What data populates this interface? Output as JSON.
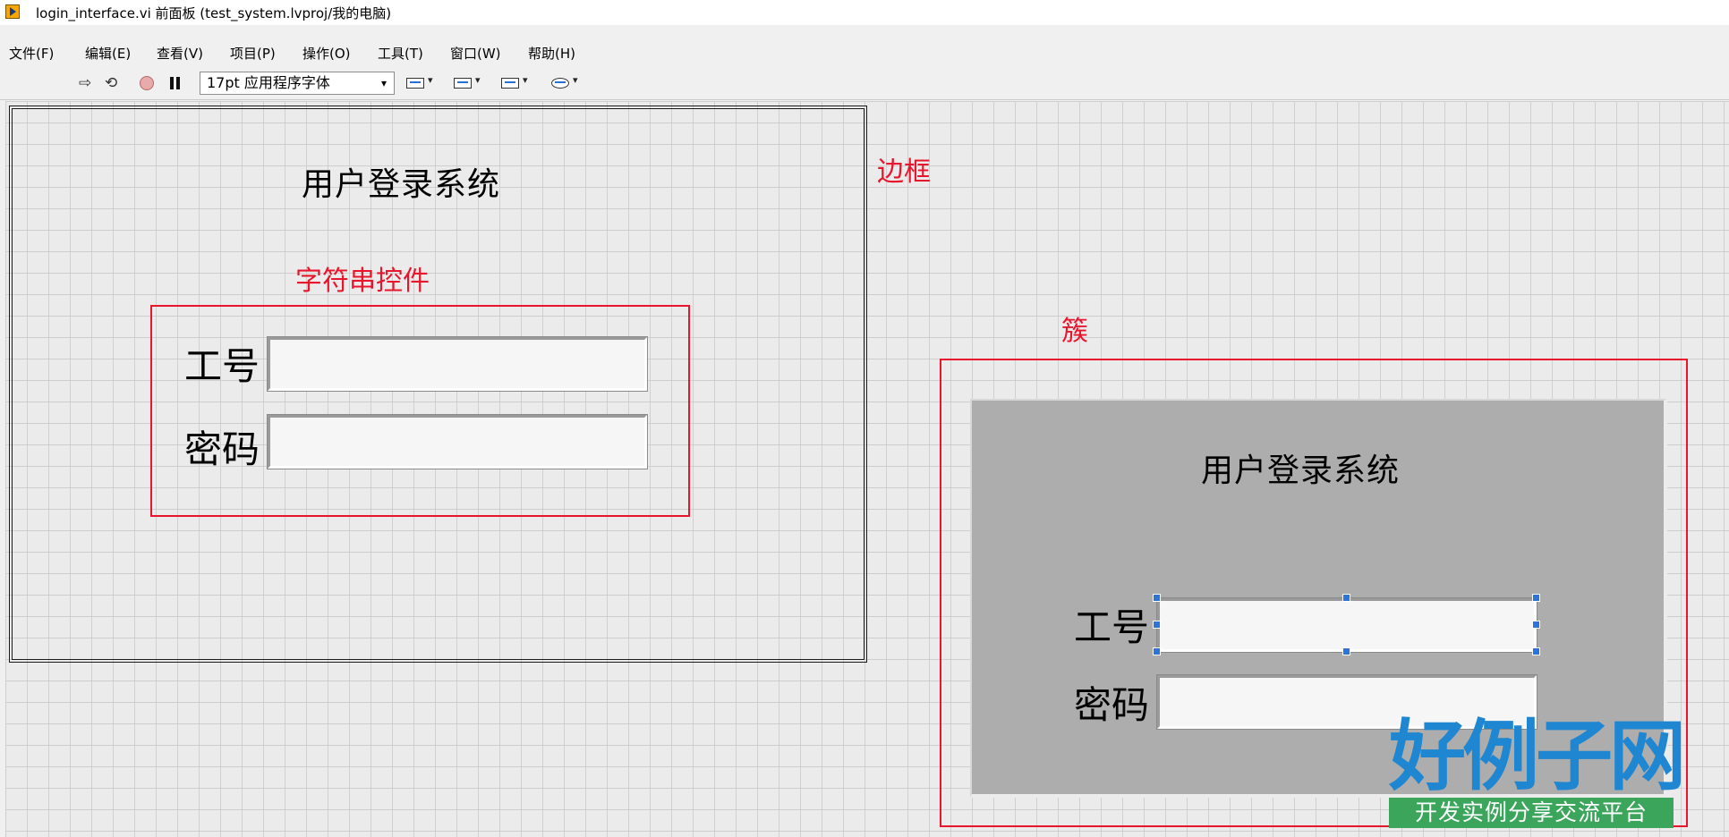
{
  "window": {
    "title": "login_interface.vi 前面板 (test_system.lvproj/我的电脑)"
  },
  "menu": [
    "文件(F)",
    "编辑(E)",
    "查看(V)",
    "项目(P)",
    "操作(O)",
    "工具(T)",
    "窗口(W)",
    "帮助(H)"
  ],
  "toolbar": {
    "run_glyph": "⇨",
    "run_continuous_glyph": "⟲",
    "font": "17pt 应用程序字体",
    "font_arrow": "▾",
    "tool_arrow": "▾",
    "tools": [
      "align-objects-icon",
      "distribute-objects-icon",
      "resize-objects-icon",
      "reorder-icon"
    ]
  },
  "panel_left": {
    "title": "用户登录系统",
    "id_label": "工号",
    "password_label": "密码",
    "id_value": "",
    "password_value": ""
  },
  "annotations": {
    "string_control": "字符串控件",
    "border": "边框",
    "cluster": "簇"
  },
  "cluster": {
    "title": "用户登录系统",
    "id_label": "工号",
    "password_label": "密码",
    "id_value": "",
    "password_value": ""
  },
  "logo": {
    "main": "好例子网",
    "sub": "开发实例分享交流平台"
  },
  "colors": {
    "annotation": "#e8162c",
    "cluster_bg": "#adadad",
    "grid": "#cfcfcf",
    "logo_blue": "#1f86d1",
    "logo_green": "#3aa55b"
  }
}
